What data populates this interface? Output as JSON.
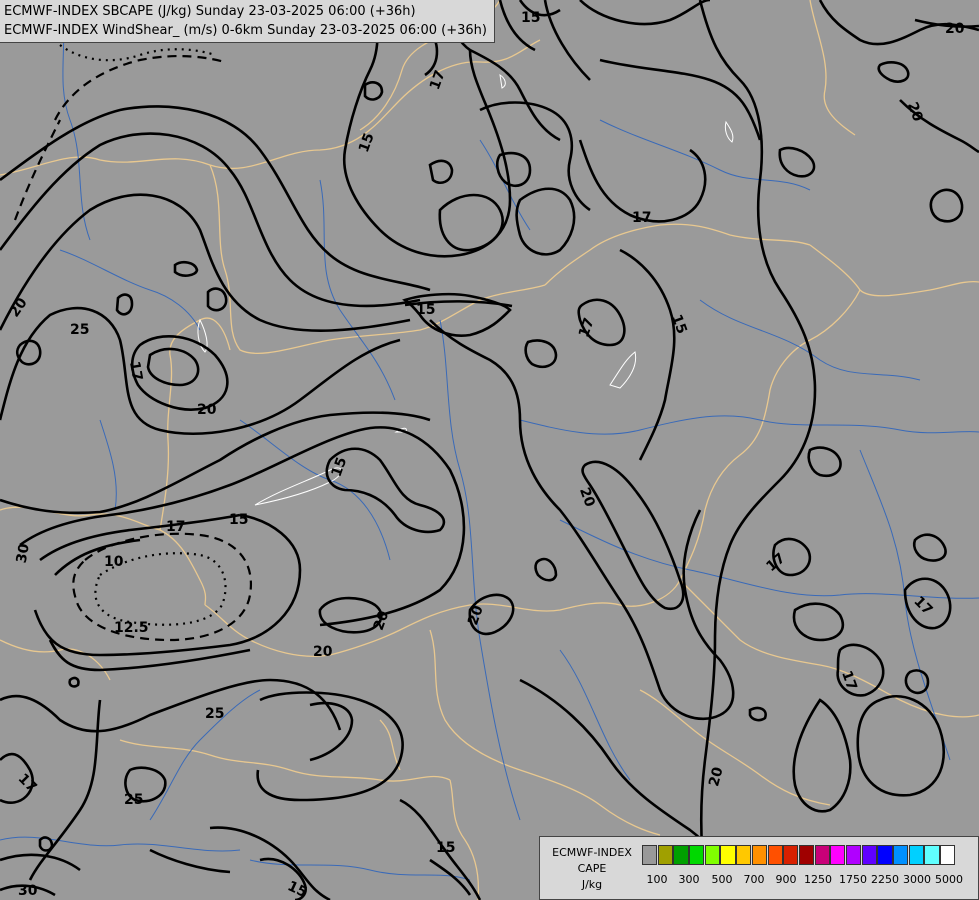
{
  "header": {
    "line1": "ECMWF-INDEX SBCAPE (J/kg) Sunday 23-03-2025 06:00 (+36h)",
    "line2": "ECMWF-INDEX WindShear_ (m/s) 0-6km Sunday 23-03-2025 06:00 (+36h)"
  },
  "map": {
    "background_color": "#9a9a9a",
    "border_color": "#e8c890",
    "river_color": "#3a6ab8",
    "contour_color": "#000000",
    "contour_labels": [
      {
        "text": "15"
      },
      {
        "text": "20"
      },
      {
        "text": "17"
      },
      {
        "text": "15"
      },
      {
        "text": "20"
      },
      {
        "text": "15"
      },
      {
        "text": "20"
      },
      {
        "text": "25"
      },
      {
        "text": "17"
      },
      {
        "text": "20"
      },
      {
        "text": "17"
      },
      {
        "text": "17"
      },
      {
        "text": "15"
      },
      {
        "text": "15"
      },
      {
        "text": "17"
      },
      {
        "text": "15"
      },
      {
        "text": "30"
      },
      {
        "text": "10"
      },
      {
        "text": "12.5"
      },
      {
        "text": "20"
      },
      {
        "text": "20"
      },
      {
        "text": "20"
      },
      {
        "text": "20"
      },
      {
        "text": "17"
      },
      {
        "text": "25"
      },
      {
        "text": "17"
      },
      {
        "text": "25"
      },
      {
        "text": "17"
      },
      {
        "text": "20"
      },
      {
        "text": "15"
      },
      {
        "text": "17"
      },
      {
        "text": "30"
      },
      {
        "text": "15"
      }
    ]
  },
  "legend": {
    "title_lines": [
      "ECMWF-INDEX",
      "CAPE",
      "J/kg"
    ],
    "colors": [
      "#999999",
      "#a0a000",
      "#00a000",
      "#00d800",
      "#80ff00",
      "#ffff00",
      "#ffc800",
      "#ff9000",
      "#ff5000",
      "#d82000",
      "#a00000",
      "#c80078",
      "#ff00ff",
      "#b000ff",
      "#6000ff",
      "#0000ff",
      "#0090ff",
      "#00d0ff",
      "#60ffff",
      "#ffffff"
    ],
    "tick_labels": [
      "100",
      "300",
      "500",
      "700",
      "900",
      "1250",
      "1750",
      "2250",
      "3000",
      "5000"
    ]
  }
}
